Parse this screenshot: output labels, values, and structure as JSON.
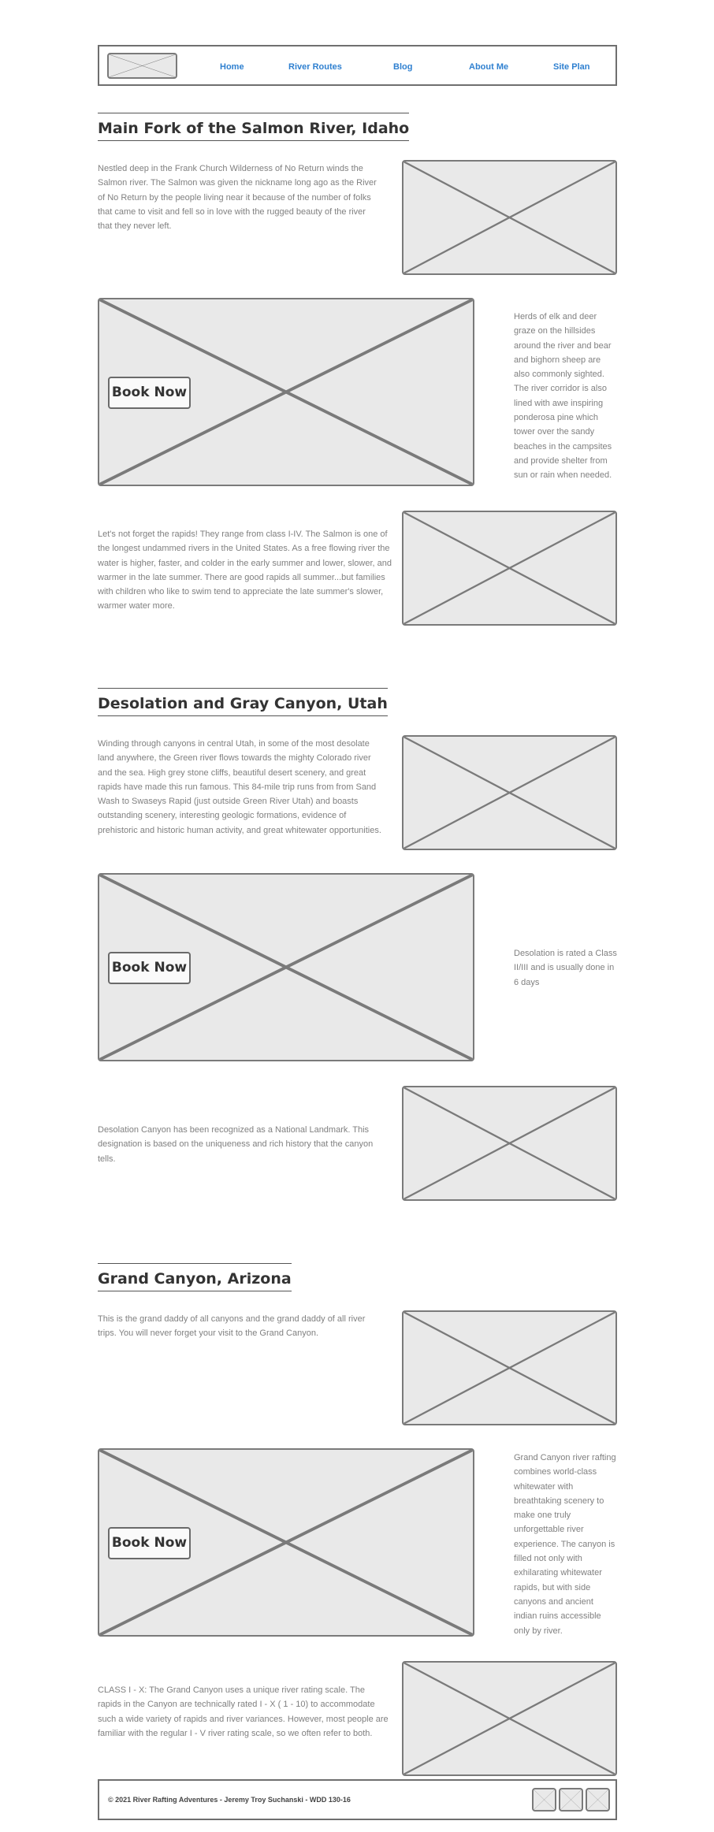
{
  "nav": {
    "logo_icon": "logo-placeholder-icon",
    "links": [
      "Home",
      "River Routes",
      "Blog",
      "About Me",
      "Site Plan"
    ]
  },
  "sections": [
    {
      "title": "Main Fork of the Salmon River, Idaho",
      "intro": "Nestled deep in the Frank Church Wilderness of No Return winds the Salmon river. The Salmon was given the nickname long ago as the River of No Return by the people living near it because of the number of folks that came to visit and fell so in love with the rugged beauty of the river that they never left.",
      "side_text": "Herds of elk and deer graze on the hillsides around the river and bear and bighorn sheep are also commonly sighted. The river corridor is also lined with awe inspiring ponderosa pine which tower over the sandy beaches in the campsites and provide shelter from sun or rain when needed.",
      "book_label": "Book Now",
      "closing": "Let's not forget the rapids! They range from class I-IV. The Salmon is one of the longest undammed rivers in the United States. As a free flowing river the water is higher, faster, and colder in the early summer and lower, slower, and warmer in the late summer. There are good rapids all summer...but families with children who like to swim tend to appreciate the late summer's slower, warmer water more."
    },
    {
      "title": "Desolation and Gray Canyon, Utah",
      "intro": "Winding through canyons in central Utah, in some of the most desolate land anywhere, the Green river flows towards the mighty Colorado river and the sea. High grey stone cliffs, beautiful desert scenery, and great rapids have made this run famous. This 84-mile trip runs from from Sand Wash to Swaseys Rapid (just outside Green River Utah) and boasts outstanding scenery, interesting geologic formations, evidence of prehistoric and historic human activity, and great whitewater opportunities.",
      "side_text": "Desolation is rated a Class II/III and is usually done in 6 days",
      "book_label": "Book Now",
      "closing": "Desolation Canyon has been recognized as a National Landmark.  This designation is based on the uniqueness and rich history that the canyon tells."
    },
    {
      "title": "Grand Canyon, Arizona",
      "intro": "This is the grand daddy of all canyons and the grand daddy of all river trips. You will never forget your visit to the Grand Canyon.",
      "side_text": "Grand Canyon river rafting combines world-class whitewater with breathtaking scenery to make one truly unforgettable river experience. The canyon is filled not only with exhilarating whitewater rapids, but with side canyons and ancient indian ruins accessible only by river.",
      "book_label": "Book Now",
      "closing": "CLASS I - X: The Grand Canyon uses a unique river rating scale. The rapids in the Canyon are technically rated I - X ( 1 - 10) to accommodate such a wide variety of rapids and river variances. However, most people are familiar with the regular I - V river rating scale, so we often refer to both."
    }
  ],
  "footer": {
    "copyright": "© 2021 River Rafting Adventures - Jeremy Troy Suchanski - WDD 130-16",
    "social_icons": [
      "social-placeholder-icon",
      "social-placeholder-icon",
      "social-placeholder-icon"
    ]
  },
  "colors": {
    "nav_link": "#2f80d0",
    "heading": "#333333",
    "body_text": "#808080",
    "placeholder_fill": "#e9e9e9",
    "placeholder_stroke": "#7a7a7a"
  }
}
